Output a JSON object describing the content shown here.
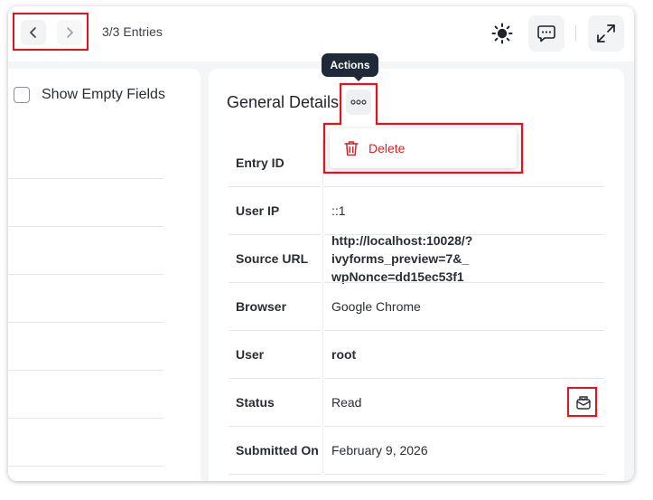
{
  "header": {
    "entries": "3/3 Entries"
  },
  "filters": {
    "show_empty_fields": "Show Empty Fields"
  },
  "details": {
    "title": "General Details",
    "actions_tooltip": "Actions",
    "actions_menu": {
      "delete": "Delete"
    },
    "rows": [
      {
        "label": "Entry ID",
        "value": ""
      },
      {
        "label": "User IP",
        "value": "::1"
      },
      {
        "label": "Source URL",
        "value": "http://localhost:10028/?ivyforms_preview=7&_wpNonce=dd15ec53f1",
        "value_line1": "http://localhost:10028/?ivyforms_preview=7&_",
        "value_line2": "wpNonce=dd15ec53f1"
      },
      {
        "label": "Browser",
        "value": "Google Chrome"
      },
      {
        "label": "User",
        "value": "root"
      },
      {
        "label": "Status",
        "value": "Read"
      },
      {
        "label": "Submitted On",
        "value": "February 9, 2026"
      }
    ]
  },
  "icons": {
    "prev": "chevron-left-icon",
    "next": "chevron-right-icon",
    "theme": "sun-icon",
    "chat": "chat-bubble-icon",
    "expand": "expand-icon",
    "more": "more-horizontal-icon",
    "delete": "trash-icon",
    "status": "mark-unread-icon"
  },
  "colors": {
    "highlight": "#e3121b",
    "danger": "#d0262b",
    "tooltip_bg": "#1f2937"
  }
}
